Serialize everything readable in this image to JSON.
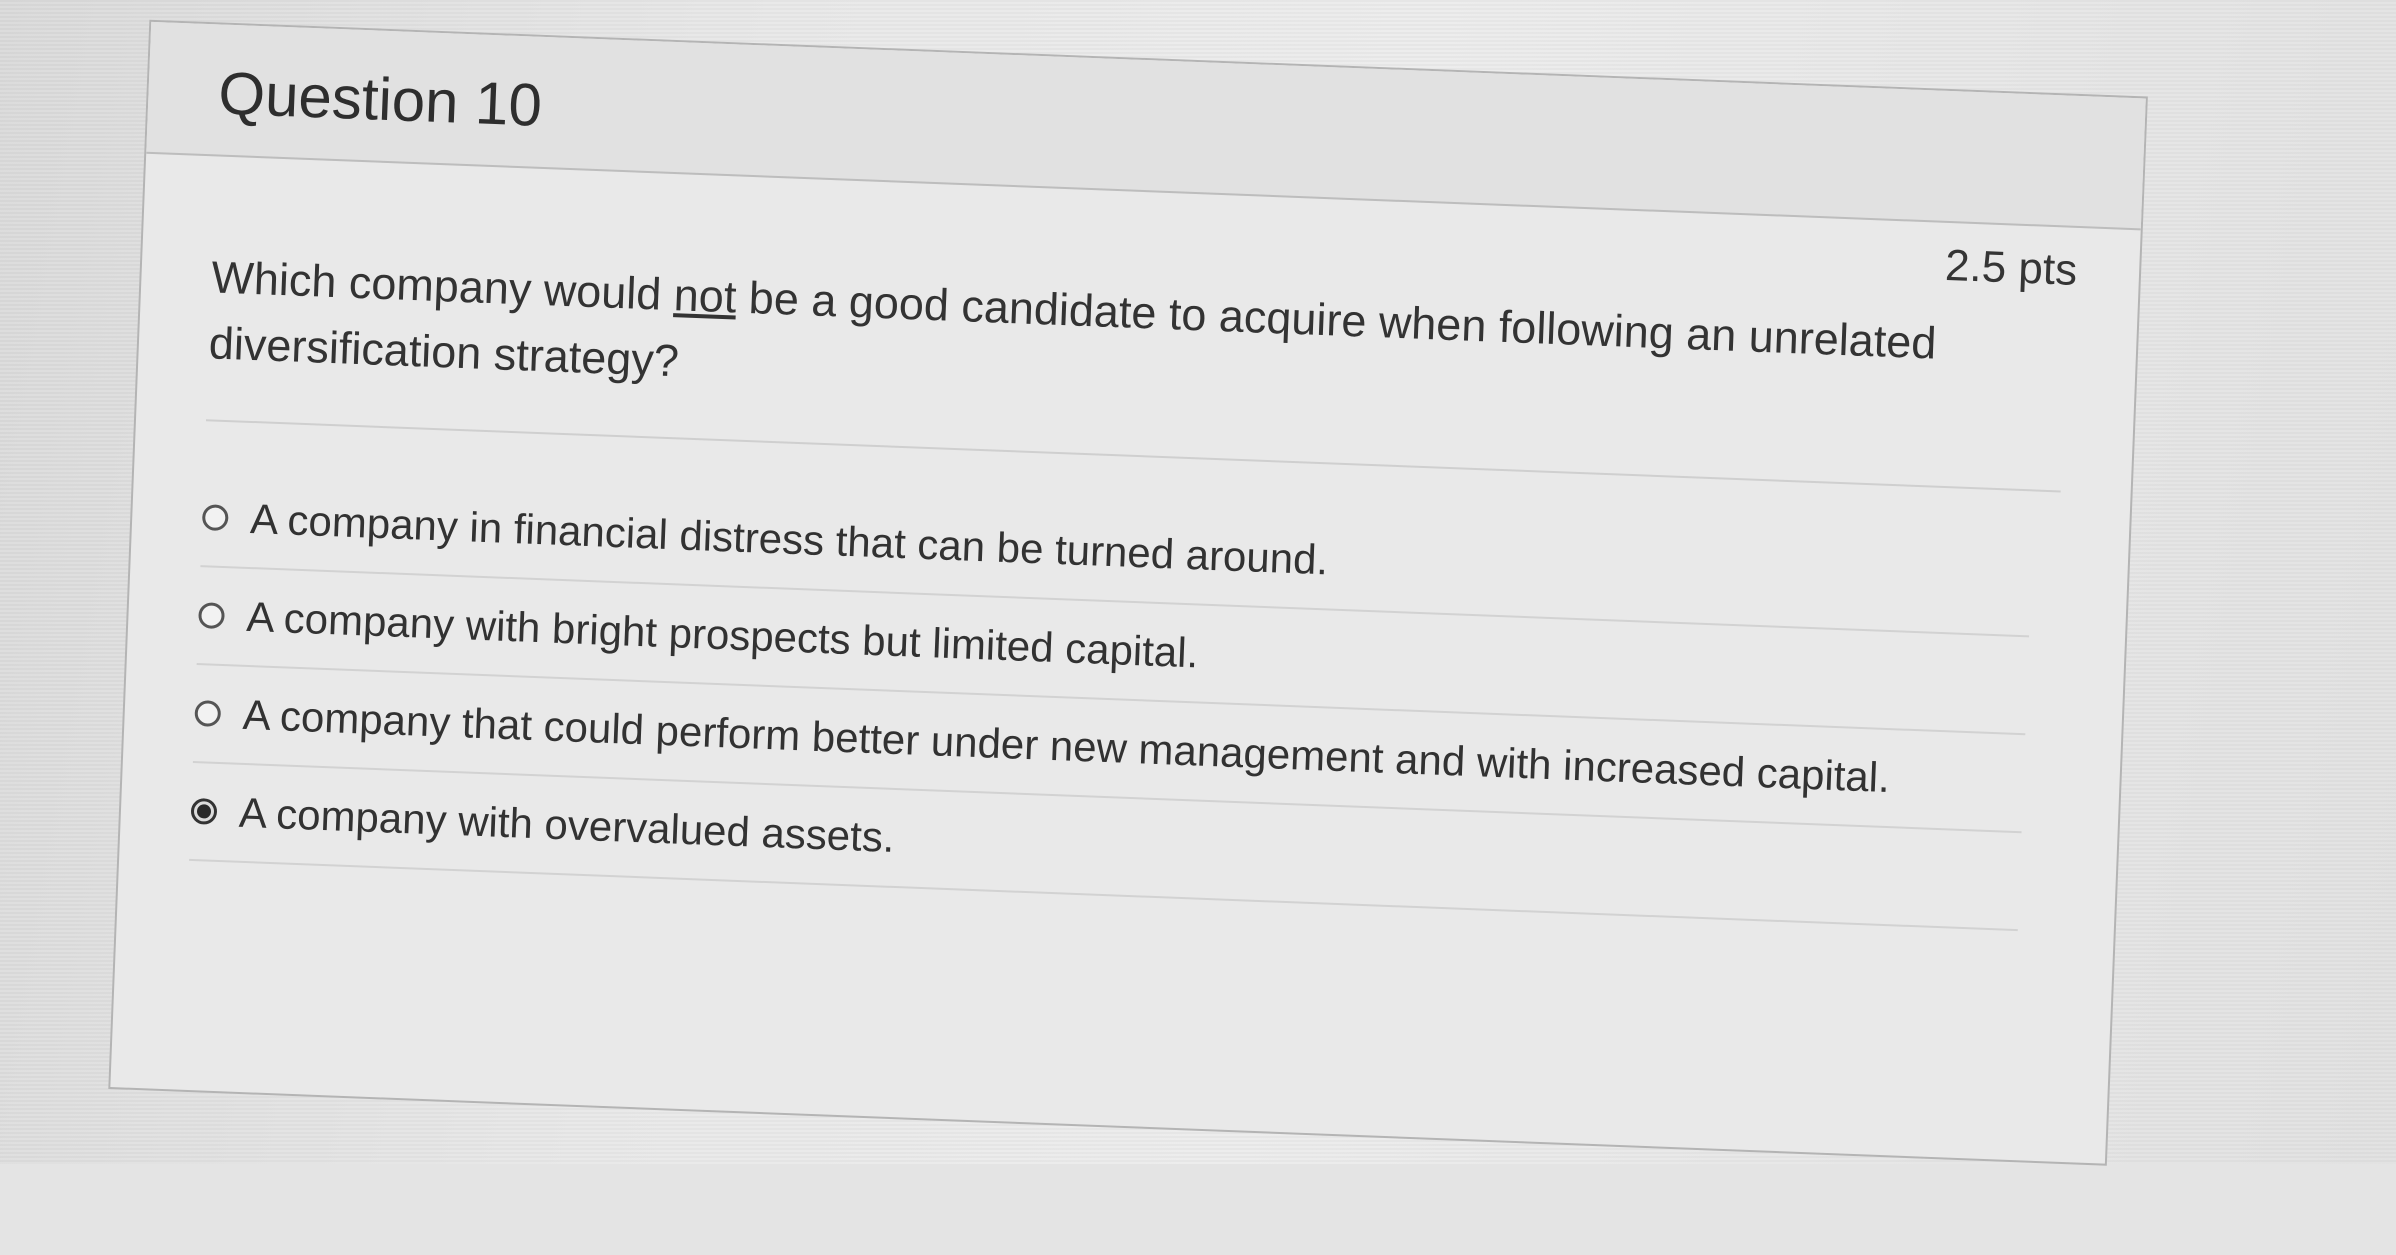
{
  "question": {
    "title": "Question 10",
    "points": "2.5 pts",
    "text_before": "Which company would ",
    "text_emphasis": "not",
    "text_after": " be a good candidate to acquire when following an unrelated diversification strategy?"
  },
  "answers": [
    {
      "label": "A company in financial distress that can be turned around.",
      "selected": false
    },
    {
      "label": "A company with bright prospects but limited capital.",
      "selected": false
    },
    {
      "label": "A company that could perform better under new management and with increased capital.",
      "selected": false
    },
    {
      "label": "A company with overvalued assets.",
      "selected": true
    }
  ],
  "colors": {
    "card_background": "#e9e9e9",
    "header_background": "#e1e1e1",
    "text": "#333333"
  }
}
